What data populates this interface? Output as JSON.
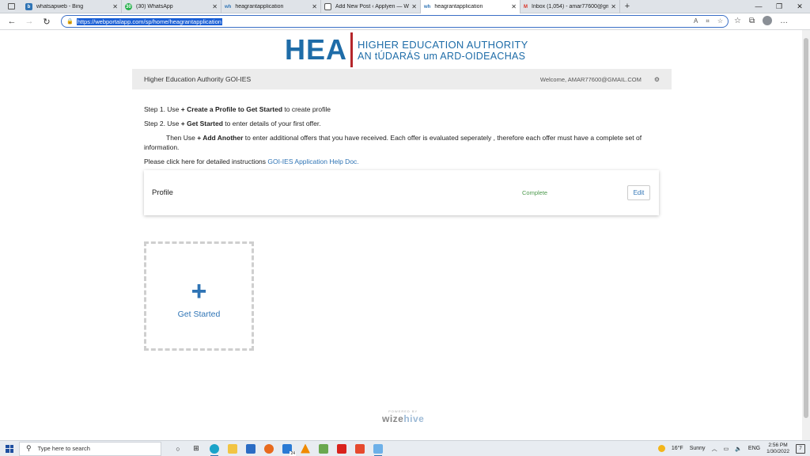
{
  "browser": {
    "tabs": [
      {
        "title": "whatsapweb - Bing",
        "favicon": "bing-icon",
        "active": false
      },
      {
        "title": "(30) WhatsApp",
        "favicon": "whatsapp-icon",
        "badge": "30",
        "active": false
      },
      {
        "title": "heagrantapplication",
        "favicon": "wh-icon",
        "fav_text": "wh",
        "active": false
      },
      {
        "title": "Add New Post ‹ Applyen — Wor",
        "favicon": "page-icon",
        "active": false
      },
      {
        "title": "heagrantapplication",
        "favicon": "wh-icon",
        "fav_text": "wh",
        "active": true
      },
      {
        "title": "Inbox (1,054) - amar77600@gm",
        "favicon": "gmail-icon",
        "fav_text": "M",
        "active": false
      }
    ],
    "url": "https://webportalapp.com/sp/home/heagrantapplication"
  },
  "logo": {
    "mark": "HEA",
    "line1": "HIGHER EDUCATION AUTHORITY",
    "line2": "AN tÚDARÁS um ARD-OIDEACHAS"
  },
  "header": {
    "org_name": "Higher Education Authority GOI-IES",
    "welcome": "Welcome, AMAR77600@GMAIL.COM"
  },
  "instructions": {
    "step1_prefix": "Step 1. Use ",
    "step1_action": "+ Create a Profile to Get Started",
    "step1_suffix": "  to create profile",
    "step2_prefix": "Step 2. Use ",
    "step2_action": "+ Get Started",
    "step2_suffix": "  to enter details of your first offer.",
    "then_prefix": "Then Use  ",
    "then_action": "+ Add Another",
    "then_suffix": "  to enter additional offers that you have received. Each offer is evaluated seperately , therefore each offer must have a complete set of information.",
    "help_prefix": "Please click here for detailed instructions ",
    "help_link": "GOI-IES Application Help Doc."
  },
  "profile": {
    "name": "Profile",
    "status": "Complete",
    "edit_label": "Edit"
  },
  "get_started": {
    "icon": "+",
    "label": "Get Started"
  },
  "footer": {
    "powered_by": "POWERED BY",
    "brand_a": "wize",
    "brand_b": "hive"
  },
  "taskbar": {
    "search_placeholder": "Type here to search",
    "weather_temp": "16°F",
    "weather_cond": "Sunny",
    "lang": "ENG",
    "time": "2:56 PM",
    "date": "1/30/2022",
    "notif_count": "7",
    "mail_badge": "24"
  },
  "colors": {
    "brand_blue": "#1e6ca8",
    "brand_red": "#b5262b",
    "link_blue": "#2f74b5",
    "complete_green": "#4d9a4d"
  }
}
